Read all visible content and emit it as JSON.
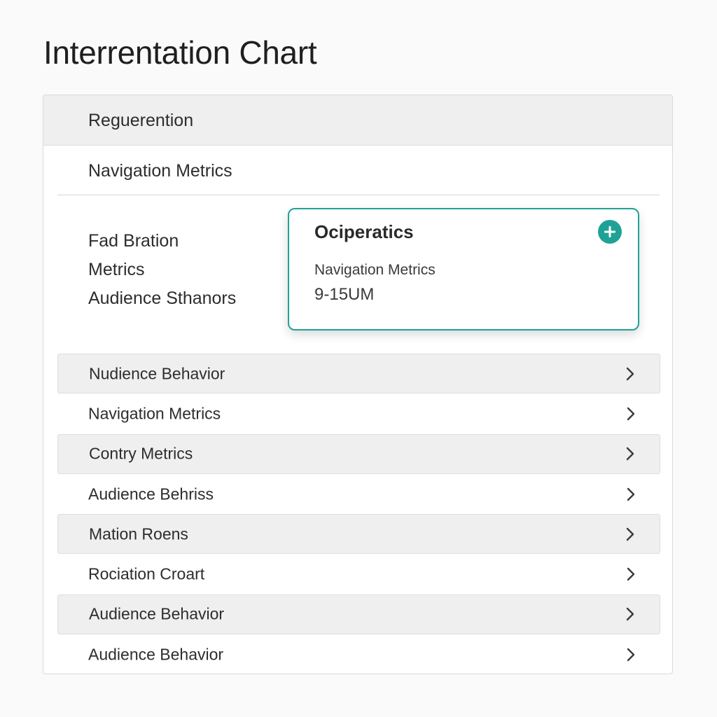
{
  "page": {
    "title": "Interrentation Chart"
  },
  "panel": {
    "header_label": "Reguerention",
    "section_title": "Navigation Metrics",
    "side_items": [
      {
        "label": "Fad Bration"
      },
      {
        "label": "Metrics"
      },
      {
        "label": "Audience Sthanors"
      }
    ]
  },
  "card": {
    "title": "Ociperatics",
    "line1": "Navigation Metrics",
    "line2": "9-15UM",
    "add_icon": "plus-circle-icon"
  },
  "rows": [
    {
      "label": "Nudience Behavior",
      "icon": "chevron-right-icon"
    },
    {
      "label": "Navigation Metrics",
      "icon": "chevron-right-icon"
    },
    {
      "label": "Contry Metrics",
      "icon": "chevron-right-icon"
    },
    {
      "label": "Audience Behriss",
      "icon": "chevron-right-icon"
    },
    {
      "label": "Mation Roens",
      "icon": "chevron-right-icon"
    },
    {
      "label": "Rociation Croart",
      "icon": "chevron-right-icon"
    },
    {
      "label": "Audience Behavior",
      "icon": "chevron-right-icon"
    },
    {
      "label": "Audience Behavior",
      "icon": "chevron-right-icon"
    }
  ],
  "colors": {
    "accent": "#1fa296",
    "row_shade": "#efefef",
    "header_bg": "#efefef"
  }
}
